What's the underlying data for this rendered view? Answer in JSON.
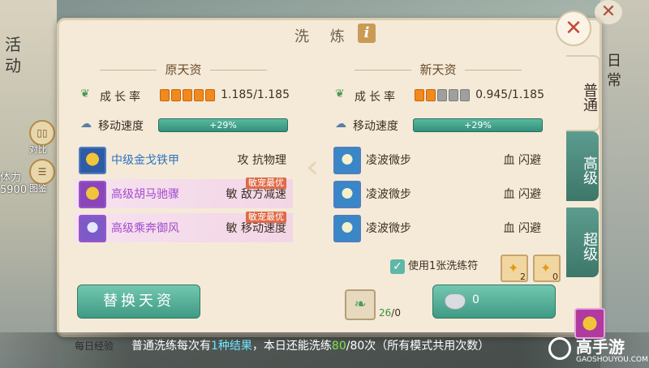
{
  "background": {
    "left_menu_label": "活动",
    "power_label": "体力",
    "power_value": "5900",
    "right_tab_label": "日常"
  },
  "dialog": {
    "title": "洗 炼",
    "info_icon": "i"
  },
  "original": {
    "header": "原天资",
    "growth_label": "成长率",
    "growth_pips_on": 5,
    "growth_pips_total": 5,
    "growth_value": "1.185/1.185",
    "speed_label": "移动速度",
    "speed_bar": "+29%",
    "skills": [
      {
        "name": "中级金戈铁甲",
        "attr": "攻 抗物理",
        "badge": ""
      },
      {
        "name": "高级胡马驰骤",
        "attr": "敏 敌方减速",
        "badge": "敏宠最优"
      },
      {
        "name": "高级乘奔御风",
        "attr": "敏 移动速度",
        "badge": "敏宠最优"
      }
    ]
  },
  "new": {
    "header": "新天资",
    "growth_label": "成长率",
    "growth_pips_on": 2,
    "growth_pips_total": 5,
    "growth_value": "0.945/1.185",
    "speed_label": "移动速度",
    "speed_bar": "+29%",
    "skills": [
      {
        "name": "凌波微步",
        "attr": "血 闪避"
      },
      {
        "name": "凌波微步",
        "attr": "血 闪避"
      },
      {
        "name": "凌波微步",
        "attr": "血 闪避"
      }
    ]
  },
  "use_ticket": {
    "checked": true,
    "label": "使用1张洗练符",
    "ticket1_count": "2",
    "ticket2_count": "0"
  },
  "buttons": {
    "replace": "替换天资",
    "refine_cost": "0"
  },
  "herb": {
    "have": "26",
    "need": "/0"
  },
  "side": {
    "compare": "对比",
    "album": "图鉴"
  },
  "tabs": [
    "普通",
    "高级",
    "超级"
  ],
  "footer": {
    "daily_exp": "每日经验",
    "t1": "普通洗练每次有",
    "n1": "1种结果",
    "t2": "，本日还能洗练",
    "n2": "80",
    "t3": "/80次（所有模式共用次数）"
  },
  "watermark": {
    "name": "高手游",
    "url": "GAOSHOUYOU.COM"
  },
  "colors": {
    "accent_teal": "#4aa88f",
    "pip_on": "#f08a1c",
    "pip_off": "#9ea0a0",
    "highlight_cyan": "#6fe3ff",
    "highlight_green": "#82e34b"
  }
}
